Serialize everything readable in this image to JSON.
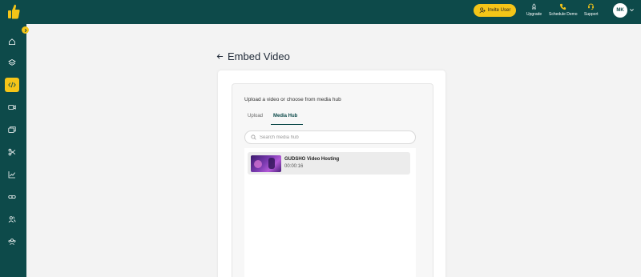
{
  "topbar": {
    "invite_label": "Invite User",
    "upgrade_label": "Upgrade",
    "schedule_label": "Schedule Demo",
    "support_label": "Support",
    "avatar_initials": "MK"
  },
  "sidebar": {
    "items": [
      {
        "icon": "home-icon"
      },
      {
        "icon": "layers-icon"
      },
      {
        "icon": "code-icon",
        "active": true
      },
      {
        "icon": "video-icon"
      },
      {
        "icon": "gallery-icon"
      },
      {
        "icon": "scissors-icon"
      },
      {
        "icon": "analytics-icon"
      },
      {
        "icon": "link-icon"
      },
      {
        "icon": "users-icon"
      },
      {
        "icon": "team-icon"
      }
    ]
  },
  "page": {
    "title": "Embed Video"
  },
  "embed": {
    "upload_label": "Upload a video or choose from media hub",
    "tabs": [
      "Upload",
      "Media Hub"
    ],
    "active_tab": "Media Hub",
    "search_placeholder": "Search media hub",
    "videos": [
      {
        "title": "GUDSHO Video Hosting",
        "duration": "00:00:16"
      }
    ]
  },
  "colors": {
    "brand_dark": "#0d4a4a",
    "accent_yellow": "#f5c518"
  }
}
